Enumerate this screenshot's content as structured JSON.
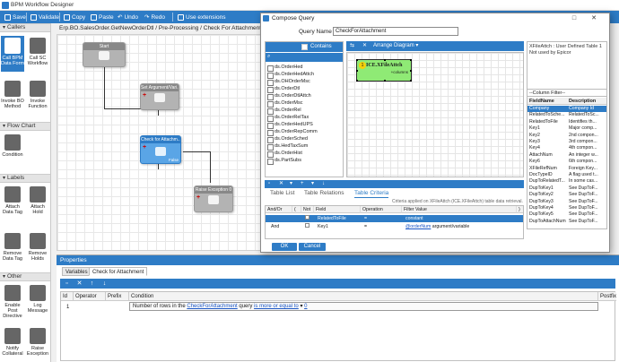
{
  "window": {
    "title": "BPM Workflow Designer"
  },
  "toolbar": {
    "save": "Save",
    "validate": "Validate",
    "copy": "Copy",
    "paste": "Paste",
    "undo": "Undo",
    "redo": "Redo",
    "use_extensions": "Use extensions"
  },
  "palette": {
    "callers_header": "Callers",
    "call_bpm_data_form": "Call BPM Data Form",
    "call_sc_workflow": "Call SC Workflow",
    "invoke_bo_method": "Invoke BO Method",
    "invoke_function": "Invoke Function",
    "flow_chart_header": "Flow Chart",
    "condition": "Condition",
    "labels_header": "Labels",
    "attach_data_tag": "Attach Data Tag",
    "attach_hold": "Attach Hold",
    "remove_data_tag": "Remove Data Tag",
    "remove_holds": "Remove Holds",
    "other_header": "Other",
    "enable_post_directive": "Enable Post Directive",
    "log_message": "Log Message",
    "notify_collateral": "Notify Collateral",
    "raise_exception": "Raise Exception"
  },
  "breadcrumb": "Erp.BO.SalesOrder.GetNewOrderDtl / Pre-Processing / Check For Attachment",
  "workflow": {
    "start": "Start",
    "set_argument": "Set Argument/Vari...",
    "check_for_attachment": "Check for Attachm...",
    "check_tag": "False",
    "raise_exception": "Raise Exception 0"
  },
  "properties": {
    "title": "Properties",
    "tabs": [
      "Variables",
      "Check for Attachment"
    ],
    "grid_headers": [
      "Id",
      "Operator",
      "Prefix",
      "Condition",
      "Postfix"
    ],
    "row": {
      "id": "1",
      "condition_pre": "Number of rows in the ",
      "condition_query": "CheckForAttachment",
      "condition_mid": " query ",
      "condition_op": "is more or equal to",
      "condition_val": "0"
    }
  },
  "dialog": {
    "title": "Compose Query",
    "query_name_label": "Query Name",
    "query_name_value": "CheckForAttachment",
    "contains_label": "Contains",
    "arrange_label": "Arrange Diagram",
    "tables": [
      "ds.OrderHed",
      "ds.OrderHedAttch",
      "ds.OHOrderMsc",
      "ds.OrderDtl",
      "ds.OrderDtlAttch",
      "ds.OrderMsc",
      "ds.OrderRel",
      "ds.OrderRelTax",
      "ds.OrderHedUPS",
      "ds.OrderRepComm",
      "ds.OrderSched",
      "ds.HedTaxSum",
      "ds.OrderHist",
      "ds.PartSubs"
    ],
    "diagram_table": {
      "name": "ICE.XFileAttch",
      "number": "1",
      "sub": "+columns"
    },
    "right_panel": {
      "info": "XFileAttch : User Defined Table 1 Not used by Epicor",
      "column_filter": "--Column Filter--",
      "headers": [
        "FieldName",
        "Description"
      ],
      "rows": [
        [
          "Company",
          "Company Id"
        ],
        [
          "RelatedToSche...",
          "RelatedToSc..."
        ],
        [
          "RelatedToFile",
          "Identifies th..."
        ],
        [
          "Key1",
          "Major comp..."
        ],
        [
          "Key2",
          "2nd compon..."
        ],
        [
          "Key3",
          "3rd compon..."
        ],
        [
          "Key4",
          "4th compon..."
        ],
        [
          "AttachNum",
          "An integer w..."
        ],
        [
          "Key6",
          "6th compon..."
        ],
        [
          "XFileRefNum",
          "Foreign Key..."
        ],
        [
          "DocTypeID",
          "A flag used t..."
        ],
        [
          "DupToRelatedT...",
          "In some cas..."
        ],
        [
          "DupToKey1",
          "See DupToF..."
        ],
        [
          "DupToKey2",
          "See DupToF..."
        ],
        [
          "DupToKey3",
          "See DupToF..."
        ],
        [
          "DupToKey4",
          "See DupToF..."
        ],
        [
          "DupToKey5",
          "See DupToF..."
        ],
        [
          "DupToAttachNum",
          "See DupToF..."
        ]
      ]
    },
    "criteria_tabs": [
      "Table List",
      "Table Relations",
      "Table Criteria"
    ],
    "criteria_note": "Criteria applied on XFileAttch (ICE.XFileAttch)  table data retrieval.",
    "criteria_headers": [
      "And/Or",
      "(",
      "Not",
      "Field",
      "Operation",
      "Filter Value",
      ")"
    ],
    "criteria_rows": [
      {
        "andor": "",
        "field": "RelatedToFile",
        "op": "=",
        "filter_link": "",
        "filter_text": "constant"
      },
      {
        "andor": "And",
        "field": "Key1",
        "op": "=",
        "filter_link": "@orderNum",
        "filter_text": " argument/variable"
      }
    ],
    "ok": "OK",
    "cancel": "Cancel"
  }
}
